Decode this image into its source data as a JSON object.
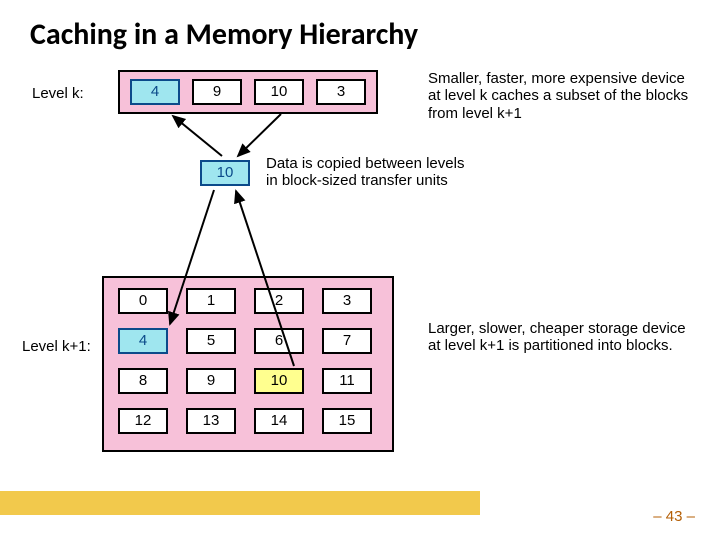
{
  "title": "Caching in a Memory Hierarchy",
  "levelK": {
    "label": "Level k:",
    "cells": [
      "4",
      "9",
      "10",
      "3"
    ],
    "description": "Smaller, faster, more expensive device at level k caches a subset of the blocks from level k+1"
  },
  "transfer": {
    "cell": "10",
    "description": "Data is copied between levels in block-sized transfer units"
  },
  "levelK1": {
    "label": "Level k+1:",
    "cells": [
      "0",
      "1",
      "2",
      "3",
      "4",
      "5",
      "6",
      "7",
      "8",
      "9",
      "10",
      "11",
      "12",
      "13",
      "14",
      "15"
    ],
    "description": "Larger, slower, cheaper storage device at level k+1 is partitioned into blocks."
  },
  "page": "– 43 –",
  "highlight": {
    "k_index": 0,
    "k1_index": 4,
    "transfer": true,
    "yellow_k1_index": 10
  }
}
